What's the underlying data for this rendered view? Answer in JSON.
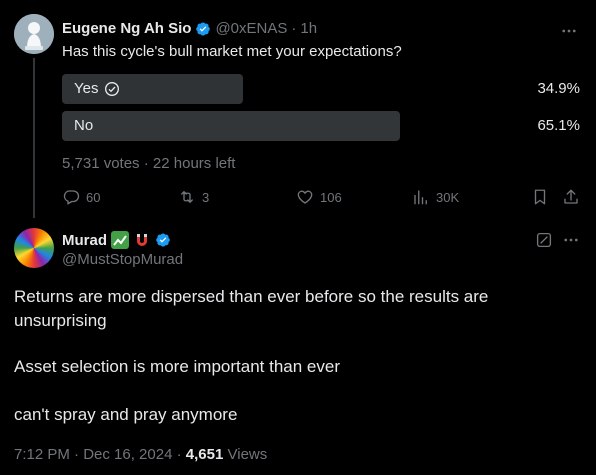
{
  "quoted": {
    "author_name": "Eugene Ng Ah Sio",
    "handle": "@0xENAS",
    "time": "1h",
    "text": "Has this cycle's bull market met your expectations?",
    "poll": {
      "options": [
        {
          "label": "Yes",
          "percent_text": "34.9%",
          "fill": 0.349,
          "winner": false,
          "checked": true
        },
        {
          "label": "No",
          "percent_text": "65.1%",
          "fill": 0.651,
          "winner": true,
          "checked": false
        }
      ],
      "votes": "5,731 votes",
      "time_left": "22 hours left"
    },
    "actions": {
      "replies": "60",
      "reposts": "3",
      "likes": "106",
      "views": "30K"
    }
  },
  "main": {
    "author_name": "Murad",
    "handle": "@MustStopMurad",
    "paragraphs": [
      "Returns are more dispersed than ever before so the results are unsurprising",
      "Asset selection is more important than ever",
      "can't spray and pray anymore"
    ],
    "timestamp": "7:12 PM · Dec 16, 2024",
    "view_count": "4,651",
    "views_label": "Views"
  },
  "colors": {
    "background": "#000000",
    "text": "#e7e9ea",
    "muted": "#71767b",
    "verified": "#1d9bf0",
    "poll_winner": "#333639",
    "poll_loser": "#2f3336"
  },
  "icons": [
    "verified-badge-icon",
    "more-icon",
    "check-circle-icon",
    "reply-icon",
    "repost-icon",
    "like-icon",
    "views-icon",
    "bookmark-icon",
    "share-icon",
    "edit-icon"
  ]
}
